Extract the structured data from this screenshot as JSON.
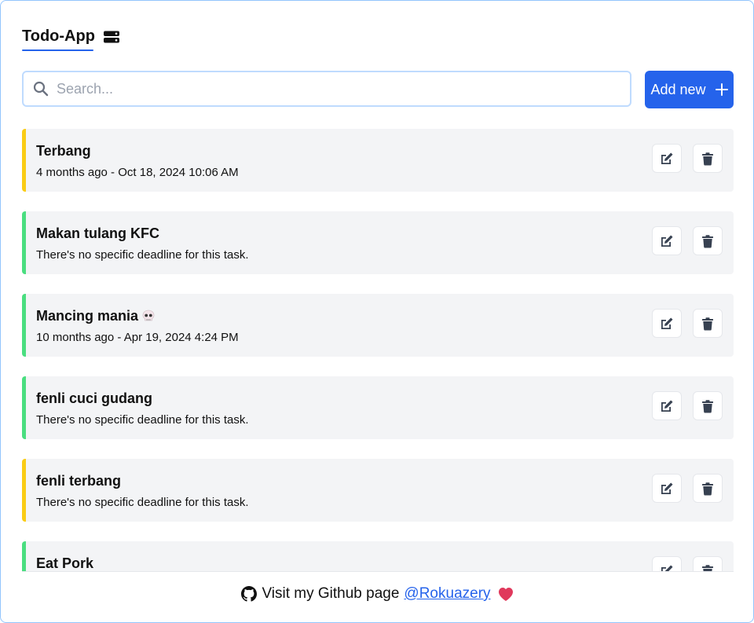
{
  "app": {
    "title": "Todo-App"
  },
  "search": {
    "placeholder": "Search...",
    "value": ""
  },
  "add_button": {
    "label": "Add new"
  },
  "todos": [
    {
      "title": "Terbang",
      "deadline": "4 months ago - Oct 18, 2024 10:06 AM",
      "status_color": "#facc15"
    },
    {
      "title": "Makan tulang KFC",
      "deadline": "There's no specific deadline for this task.",
      "status_color": "#4ade80"
    },
    {
      "title": "Mancing mania",
      "deadline": "10 months ago - Apr 19, 2024 4:24 PM",
      "status_color": "#4ade80",
      "icon": "skull-icon"
    },
    {
      "title": "fenli cuci gudang",
      "deadline": "There's no specific deadline for this task.",
      "status_color": "#4ade80"
    },
    {
      "title": "fenli terbang",
      "deadline": "There's no specific deadline for this task.",
      "status_color": "#facc15"
    },
    {
      "title": "Eat Pork",
      "deadline": "",
      "status_color": "#4ade80"
    }
  ],
  "footer": {
    "text": "Visit my Github page",
    "link_text": "@Rokuazery"
  },
  "colors": {
    "accent": "#2563eb",
    "pending": "#facc15",
    "done": "#4ade80"
  }
}
